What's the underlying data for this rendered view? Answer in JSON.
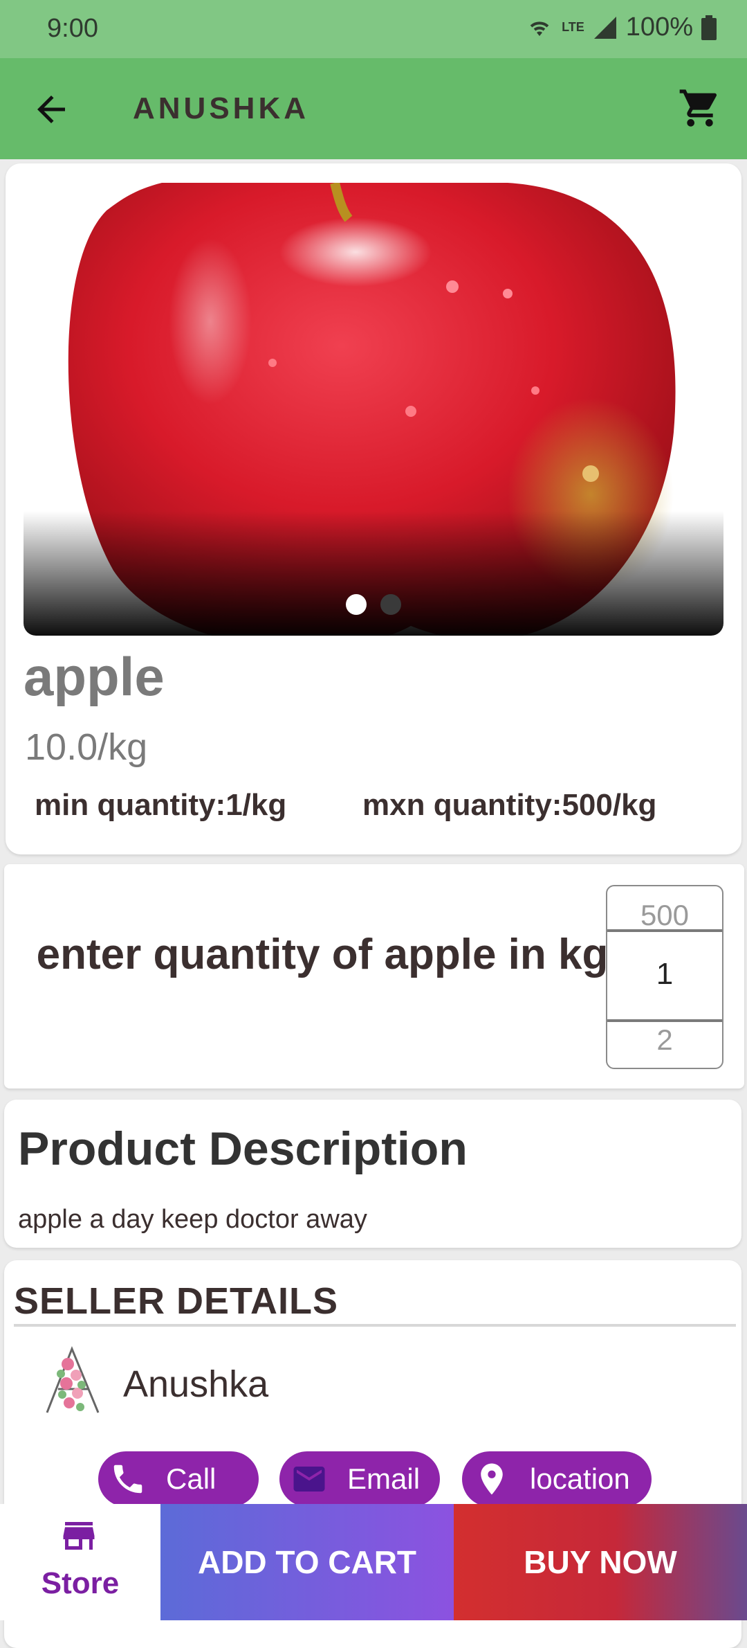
{
  "status_bar": {
    "time": "9:00",
    "network": "LTE",
    "battery": "100%"
  },
  "app_bar": {
    "title": "ANUSHKA"
  },
  "product": {
    "name": "apple",
    "price": "10.0/kg",
    "min_quantity": "min quantity:1/kg",
    "max_quantity": "mxn quantity:500/kg",
    "carousel_page_count": 2,
    "carousel_active_page": 1
  },
  "quantity": {
    "label": "enter quantity of apple in kg",
    "picker_prev": "500",
    "picker_current": "1",
    "picker_next": "2"
  },
  "description": {
    "title": "Product Description",
    "text": "apple a day keep doctor away"
  },
  "seller": {
    "title": "SELLER DETAILS",
    "name": "Anushka",
    "call_label": "Call",
    "email_label": "Email",
    "location_label": "location"
  },
  "bottom_bar": {
    "store_label": "Store",
    "add_to_cart_label": "ADD TO CART",
    "buy_now_label": "BUY NOW"
  },
  "colors": {
    "status_bar": "#81c784",
    "app_bar": "#66bb6a",
    "accent_purple": "#8e24aa",
    "buy_red": "#d32f2f"
  },
  "icons": [
    "back-arrow-icon",
    "cart-icon",
    "phone-icon",
    "email-icon",
    "location-pin-icon",
    "store-icon",
    "wifi-icon",
    "signal-icon",
    "battery-icon"
  ]
}
